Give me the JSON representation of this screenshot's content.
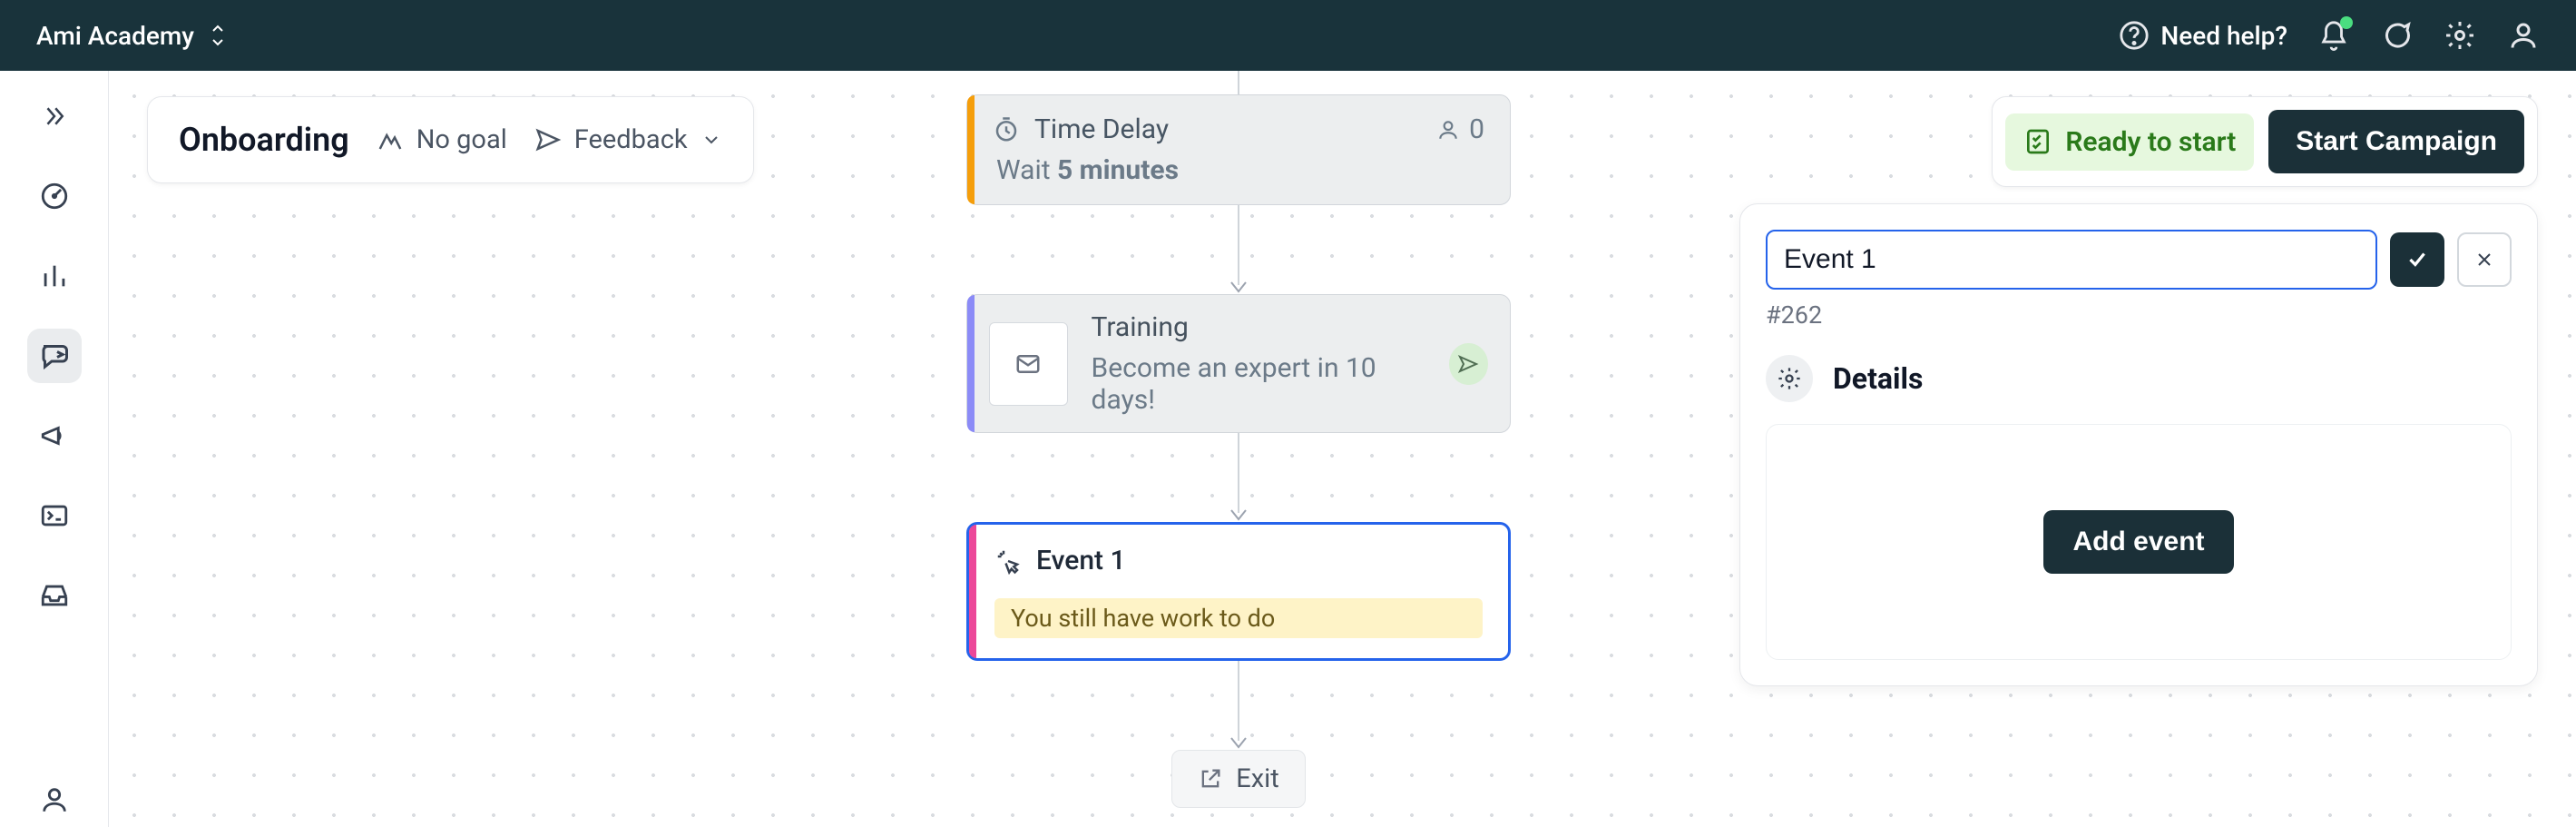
{
  "header": {
    "workspace": "Ami Academy",
    "need_help": "Need help?"
  },
  "flow": {
    "title": "Onboarding",
    "goal_label": "No goal",
    "feedback_label": "Feedback",
    "ready_label": "Ready to start",
    "start_label": "Start Campaign"
  },
  "nodes": {
    "delay": {
      "title": "Time Delay",
      "people": "0",
      "wait_prefix": "Wait",
      "wait_value": "5 minutes"
    },
    "email": {
      "title": "Training",
      "subtitle": "Become an expert in 10 days!"
    },
    "event": {
      "title": "Event 1",
      "warning": "You still have work to do"
    },
    "exit": {
      "label": "Exit"
    }
  },
  "details": {
    "input_value": "Event 1",
    "id_label": "#262",
    "section_label": "Details",
    "add_event_label": "Add event"
  }
}
